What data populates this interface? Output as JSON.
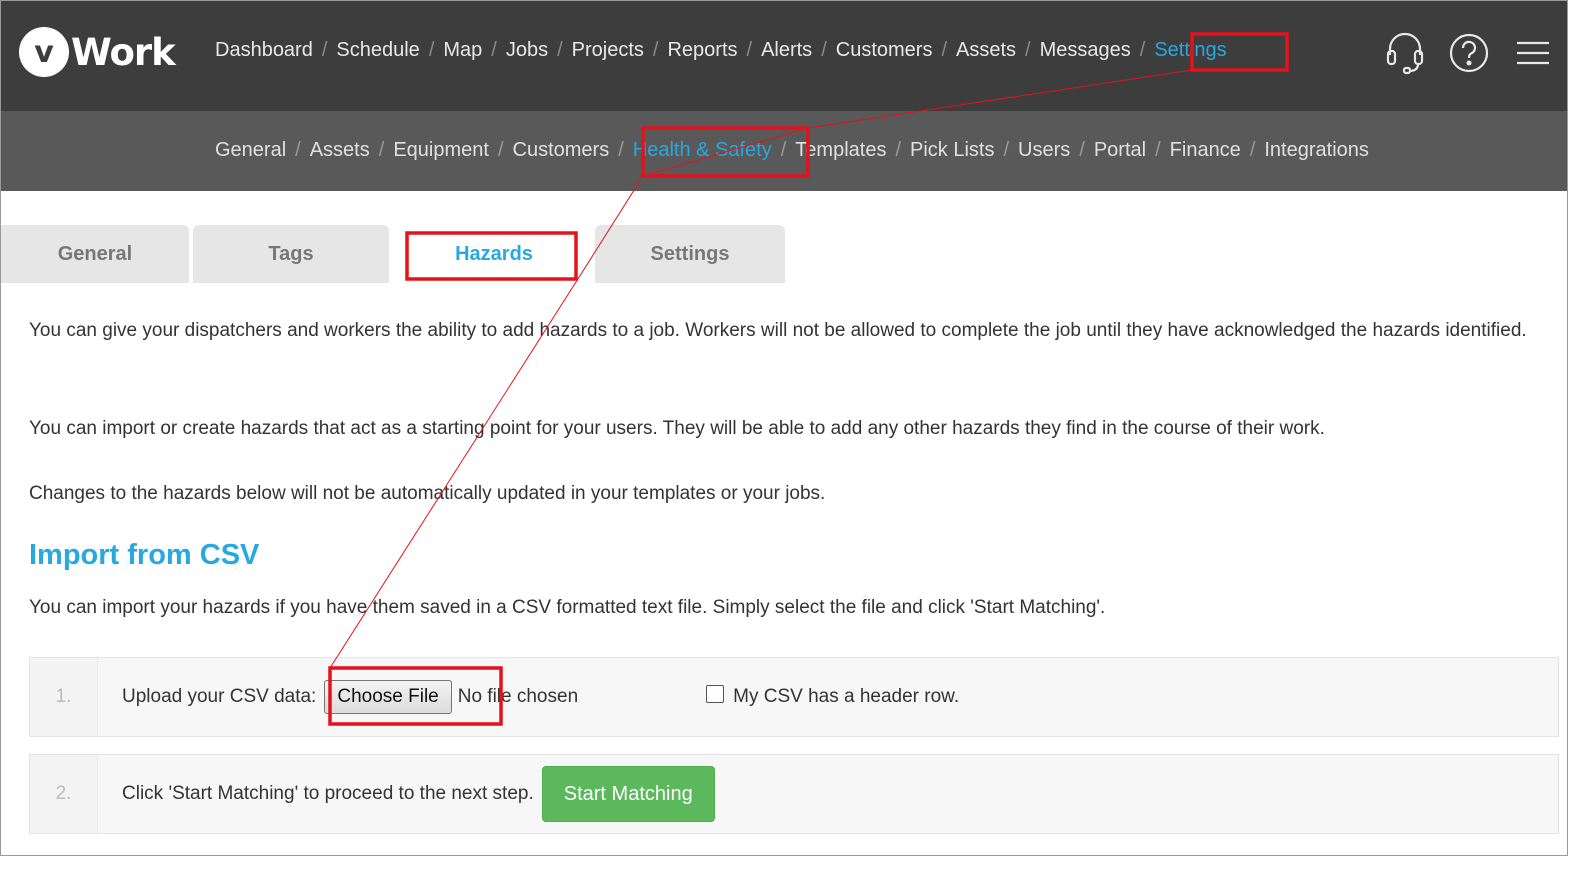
{
  "app": {
    "logo_text": "Work",
    "logo_letter": "v"
  },
  "main_nav": {
    "items": [
      "Dashboard",
      "Schedule",
      "Map",
      "Jobs",
      "Projects",
      "Reports",
      "Alerts",
      "Customers",
      "Assets",
      "Messages",
      "Settings"
    ],
    "active": "Settings"
  },
  "top_icons": [
    "headset-icon",
    "help-icon",
    "hamburger-menu-icon"
  ],
  "sub_nav": {
    "items": [
      "General",
      "Assets",
      "Equipment",
      "Customers",
      "Health & Safety",
      "Templates",
      "Pick Lists",
      "Users",
      "Portal",
      "Finance",
      "Integrations"
    ],
    "active": "Health & Safety"
  },
  "tabs": {
    "items": [
      "General",
      "Tags",
      "Hazards",
      "Settings"
    ],
    "active": "Hazards"
  },
  "content": {
    "para1": "You can give your dispatchers and workers the ability to add hazards to a job. Workers will not be allowed to complete the job until they have acknowledged the hazards identified.",
    "para2": "You can import or create hazards that act as a starting point for your users. They will be able to add any other hazards they find in the course of their work.",
    "para3": "Changes to the hazards below will not be automatically updated in your templates or your jobs.",
    "import_heading": "Import from CSV",
    "import_desc": "You can import your hazards if you have them saved in a CSV formatted text file. Simply select the file and click 'Start Matching'."
  },
  "step1": {
    "number": "1.",
    "label": "Upload your CSV data:",
    "choose_file_label": "Choose File",
    "file_status": "No file chosen",
    "header_checkbox_label": "My CSV has a header row.",
    "header_checked": false
  },
  "step2": {
    "number": "2.",
    "label": "Click 'Start Matching' to proceed to the next step.",
    "button_label": "Start Matching"
  },
  "colors": {
    "accent": "#29a8e0",
    "topbar": "#3d3d3d",
    "subbar": "#595959",
    "success": "#5cb85c",
    "annotation": "#e3121b"
  }
}
